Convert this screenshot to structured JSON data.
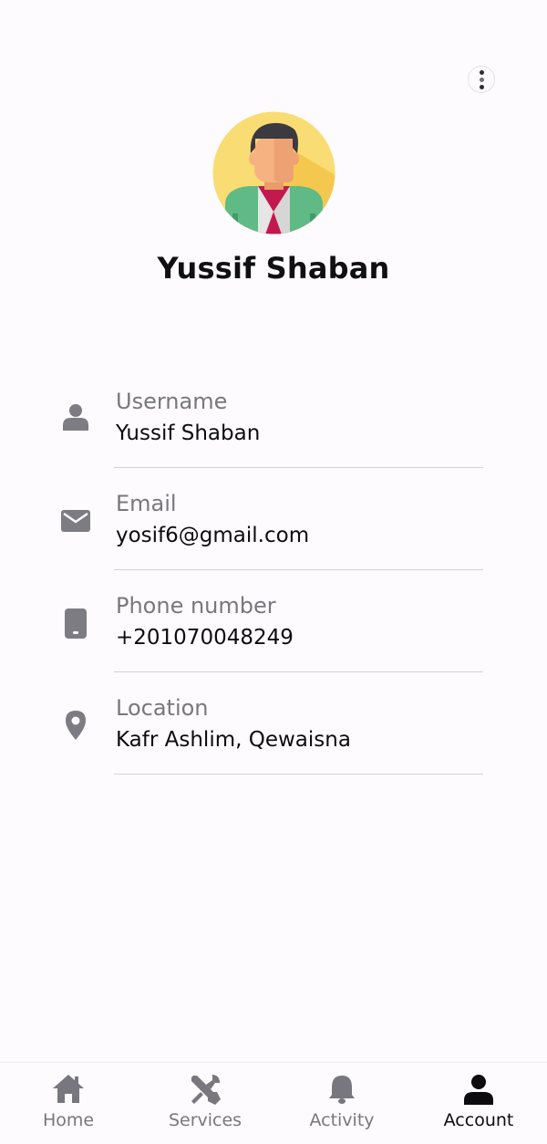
{
  "header": {
    "more_icon": "more-vert-icon"
  },
  "profile": {
    "name": "Yussif Shaban",
    "avatar_icon": "user-avatar-illustration"
  },
  "info": [
    {
      "icon": "person-icon",
      "label": "Username",
      "value": "Yussif Shaban"
    },
    {
      "icon": "email-icon",
      "label": "Email",
      "value": "yosif6@gmail.com"
    },
    {
      "icon": "phone-icon",
      "label": "Phone number",
      "value": "+201070048249"
    },
    {
      "icon": "location-pin-icon",
      "label": "Location",
      "value": "Kafr Ashlim, Qewaisna"
    }
  ],
  "nav": [
    {
      "icon": "home-icon",
      "label": "Home",
      "active": false
    },
    {
      "icon": "tools-icon",
      "label": "Services",
      "active": false
    },
    {
      "icon": "bell-icon",
      "label": "Activity",
      "active": false
    },
    {
      "icon": "account-icon",
      "label": "Account",
      "active": true
    }
  ],
  "colors": {
    "background": "#fdfbfe",
    "muted_icon": "#7c7c82",
    "active": "#0c0c10"
  }
}
